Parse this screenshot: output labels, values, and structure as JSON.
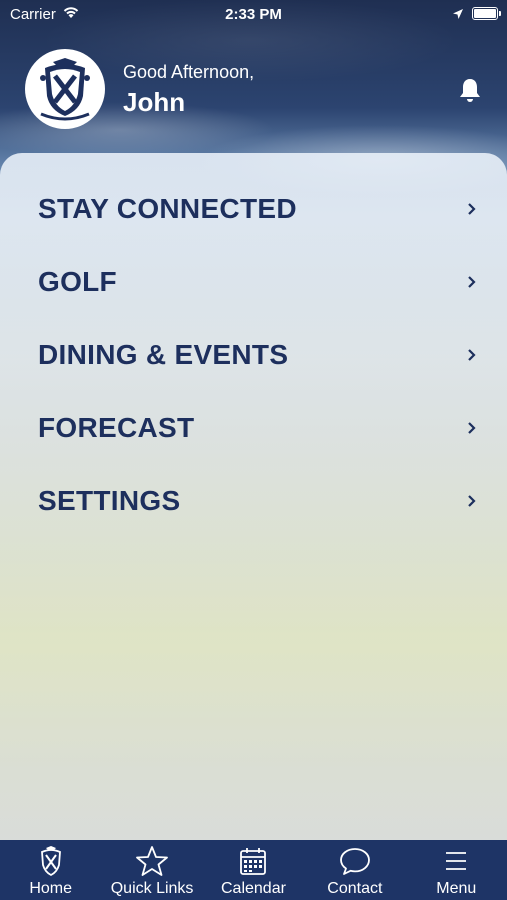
{
  "status_bar": {
    "carrier": "Carrier",
    "time": "2:33 PM"
  },
  "header": {
    "greeting": "Good Afternoon,",
    "user_name": "John",
    "logo_icon": "club-crest-icon",
    "notification_icon": "bell-icon"
  },
  "menu": {
    "items": [
      {
        "label": "STAY CONNECTED"
      },
      {
        "label": "GOLF"
      },
      {
        "label": "DINING & EVENTS"
      },
      {
        "label": "FORECAST"
      },
      {
        "label": "SETTINGS"
      }
    ]
  },
  "tab_bar": {
    "tabs": [
      {
        "label": "Home",
        "icon": "club-crest-icon"
      },
      {
        "label": "Quick Links",
        "icon": "star-icon"
      },
      {
        "label": "Calendar",
        "icon": "calendar-icon"
      },
      {
        "label": "Contact",
        "icon": "chat-bubble-icon"
      },
      {
        "label": "Menu",
        "icon": "hamburger-menu-icon"
      }
    ]
  },
  "colors": {
    "brand_navy": "#1d2f5d",
    "tab_bar_bg": "#1e3466"
  }
}
